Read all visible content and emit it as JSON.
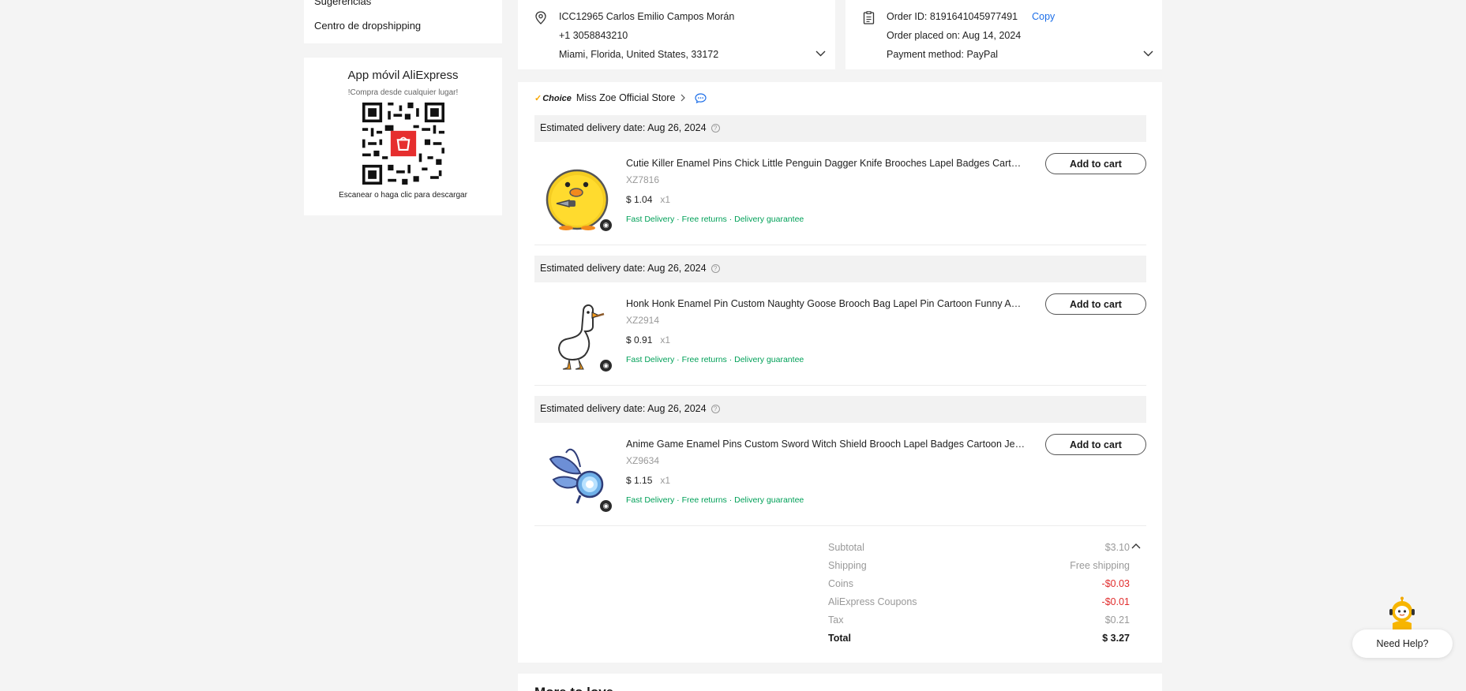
{
  "sidebar": {
    "links": [
      "Sugerencias",
      "Centro de dropshipping"
    ],
    "app": {
      "title": "App móvil AliExpress",
      "subtitle": "!Compra desde cualquier lugar!",
      "scan_text": "Escanear o haga clic para descargar"
    }
  },
  "address": {
    "name_line": "ICC12965 Carlos Emilio Campos Morán",
    "phone": "+1 3058843210",
    "location": "Miami, Florida, United States, 33172"
  },
  "order": {
    "id_line": "Order ID: 8191641045977491",
    "copy_label": "Copy",
    "placed_line": "Order placed on: Aug 14, 2024",
    "payment_line": "Payment method: PayPal"
  },
  "store": {
    "badge": "Choice",
    "name": "Miss Zoe Official Store"
  },
  "items": [
    {
      "delivery": "Estimated delivery date: Aug 26, 2024",
      "title": "Cutie Killer Enamel Pins Chick Little Penguin Dagger Knife Brooches Lapel Badges Cartoon Funny Animal Jewelry Gift",
      "sku": "XZ7816",
      "price": "$ 1.04",
      "qty": "x1",
      "tags": "Fast Delivery · Free returns · Delivery guarantee",
      "button": "Add to cart"
    },
    {
      "delivery": "Estimated delivery date: Aug 26, 2024",
      "title": "Honk Honk Enamel Pin Custom Naughty Goose Brooch Bag Lapel Pin Cartoon Funny Animal Badge Jewelry Gift",
      "sku": "XZ2914",
      "price": "$ 0.91",
      "qty": "x1",
      "tags": "Fast Delivery · Free returns · Delivery guarantee",
      "button": "Add to cart"
    },
    {
      "delivery": "Estimated delivery date: Aug 26, 2024",
      "title": "Anime Game Enamel Pins Custom Sword Witch Shield Brooch Lapel Badges Cartoon Jewelry Gift for Friends",
      "sku": "XZ9634",
      "price": "$ 1.15",
      "qty": "x1",
      "tags": "Fast Delivery · Free returns · Delivery guarantee",
      "button": "Add to cart"
    }
  ],
  "summary": [
    {
      "label": "Subtotal",
      "value": "$3.10"
    },
    {
      "label": "Shipping",
      "value": "Free shipping"
    },
    {
      "label": "Coins",
      "value": "-$0.03"
    },
    {
      "label": "AliExpress Coupons",
      "value": "-$0.01"
    },
    {
      "label": "Tax",
      "value": "$0.21"
    },
    {
      "label": "Total",
      "value": "$ 3.27"
    }
  ],
  "more_to_love": "More to love",
  "help_label": "Need Help?",
  "colors": {
    "link": "#1c6ee8",
    "green": "#00a058",
    "discount": "#e12c2c",
    "choice": "#f7a600"
  }
}
